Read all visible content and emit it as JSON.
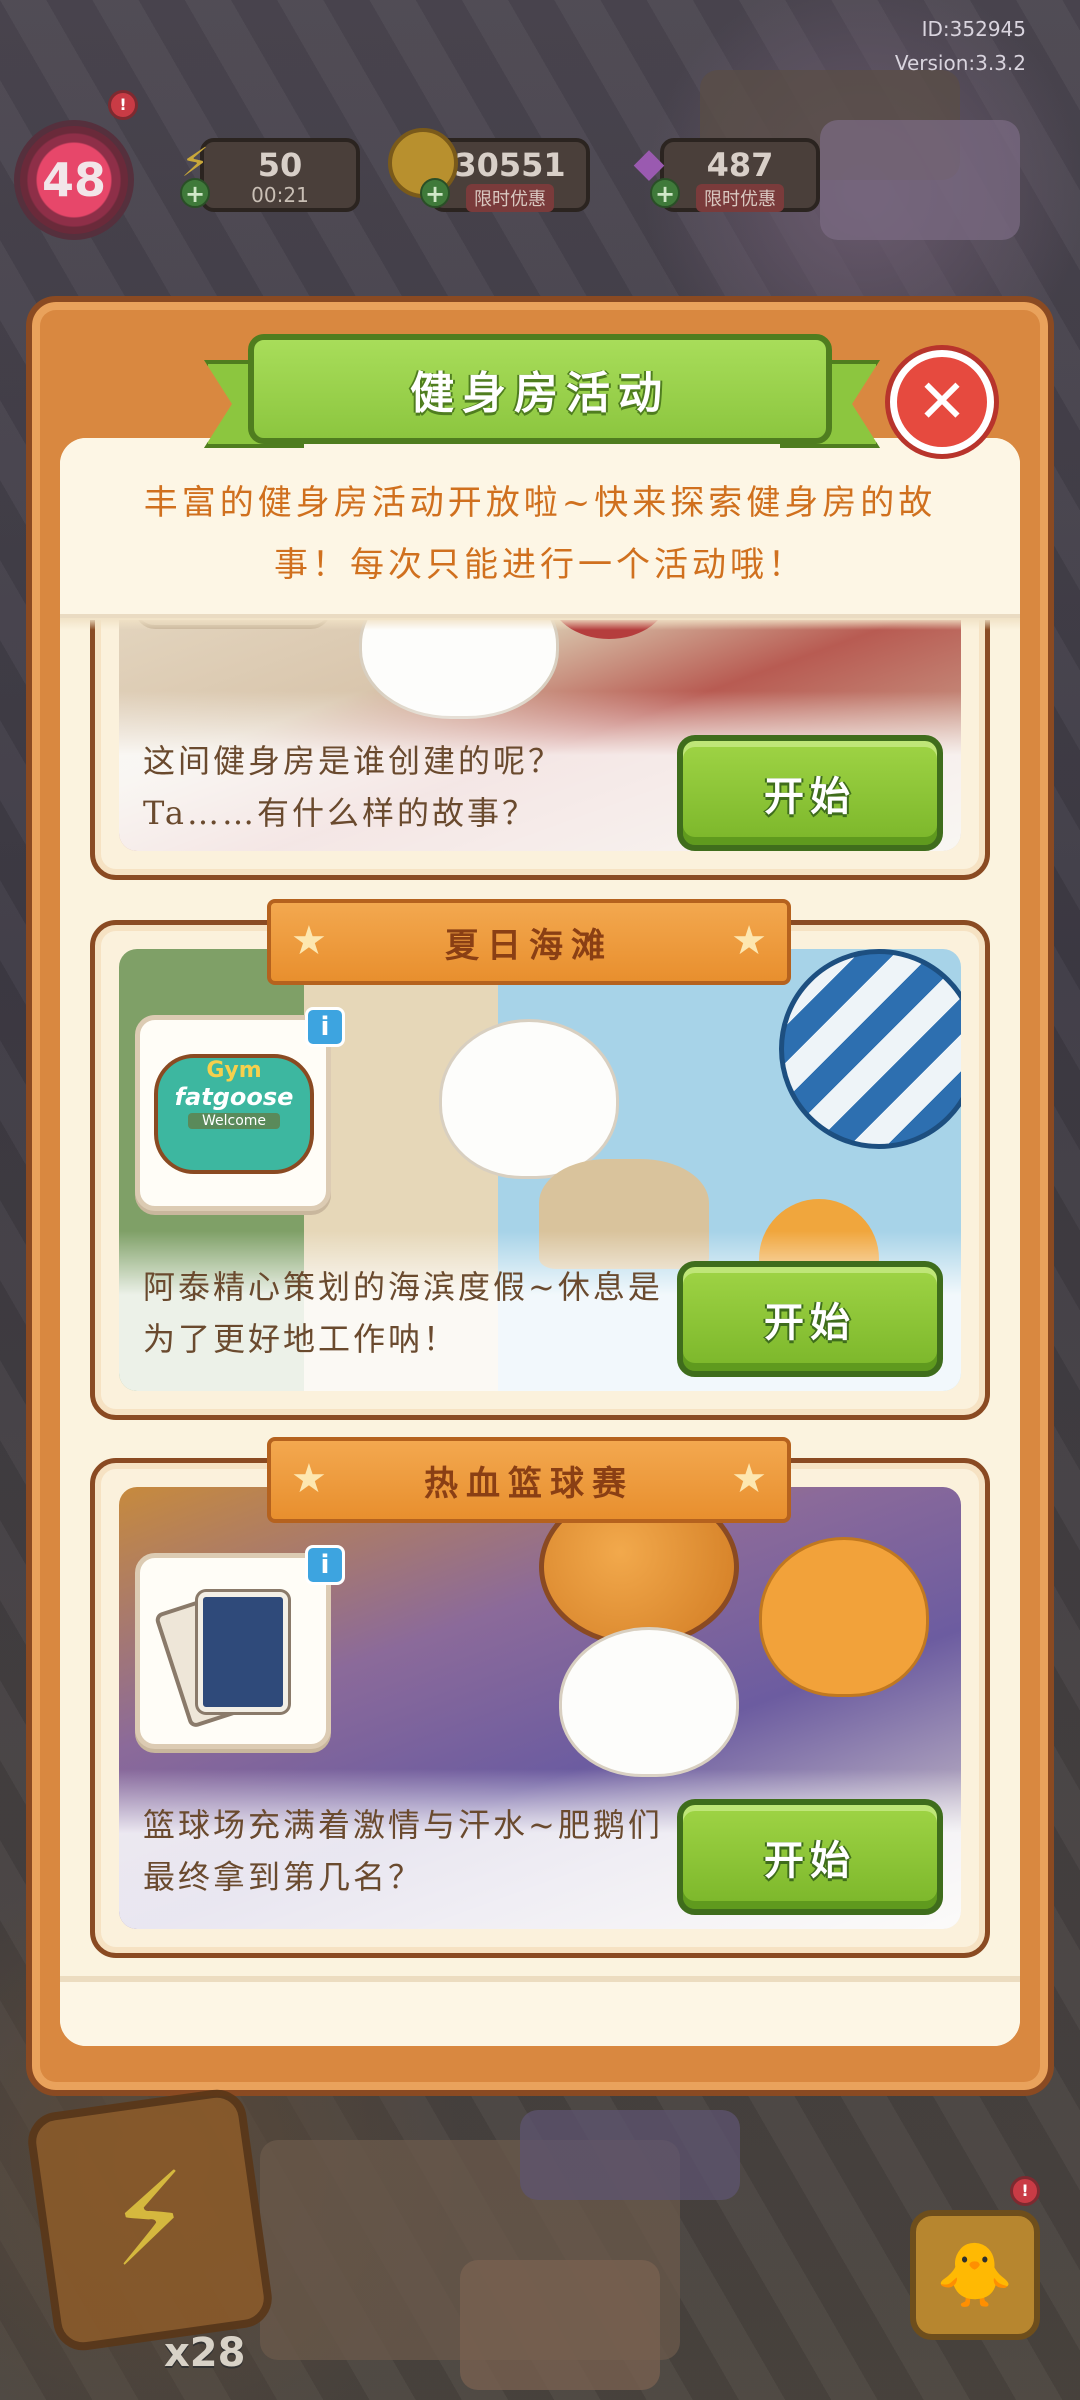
{
  "hud": {
    "player_id": "ID:352945",
    "version": "Version:3.3.2",
    "level": "48",
    "energy": {
      "value": "50",
      "timer": "00:21"
    },
    "coins": {
      "value": "30551",
      "tag": "限时优惠"
    },
    "gems": {
      "value": "487",
      "tag": "限时优惠"
    },
    "notification_mark": "!"
  },
  "dialog": {
    "title": "健身房活动",
    "description": "丰富的健身房活动开放啦~快来探索健身房的故事！每次只能进行一个活动哦！",
    "close_symbol": "✕",
    "activities": [
      {
        "title": "",
        "description": "这间健身房是谁创建的呢？Ta……有什么样的故事？",
        "button_label": "开始",
        "completed_mark": "✔"
      },
      {
        "title": "夏日海滩",
        "description": "阿泰精心策划的海滨度假~休息是为了更好地工作呐！",
        "button_label": "开始",
        "info_mark": "i",
        "reward_icon": "fatgoose-gym-sign-icon",
        "reward_sign": {
          "line1": "Gym",
          "line2": "fatgoose",
          "line3": "Welcome"
        }
      },
      {
        "title": "热血篮球赛",
        "description": "篮球场充满着激情与汗水~肥鹅们最终拿到第几名？",
        "button_label": "开始",
        "info_mark": "i",
        "reward_icon": "photo-cards-icon"
      }
    ]
  },
  "bottom_hud": {
    "item_count": "x28"
  },
  "colors": {
    "panel_orange": "#d98840",
    "title_green": "#8cc63f",
    "button_green": "#7bb62a",
    "close_red": "#e64a3f",
    "card_title_orange": "#e88f2e",
    "info_blue": "#3da4e0"
  }
}
